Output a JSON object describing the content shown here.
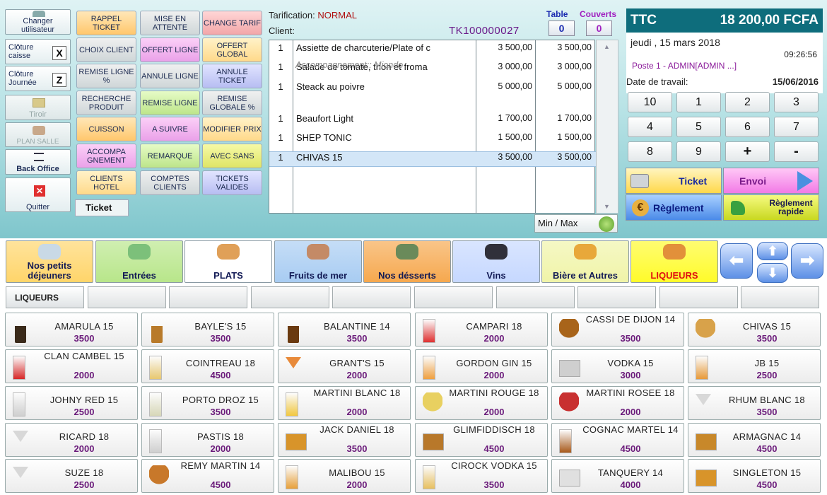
{
  "left": {
    "change_user": "Changer utilisateur",
    "cloture_caisse": "Clôture caisse",
    "cloture_caisse_key": "X",
    "cloture_journee": "Clôture Journée",
    "cloture_journee_key": "Z",
    "tiroir": "Tiroir",
    "plan_salle": "PLAN SALLE",
    "back_office": "Back Office",
    "quitter": "Quitter"
  },
  "functions": [
    {
      "label": "RAPPEL TICKET",
      "color": "or"
    },
    {
      "label": "MISE EN ATTENTE",
      "color": "gr"
    },
    {
      "label": "CHANGE TARIF",
      "color": "rd"
    },
    {
      "label": "CHOIX CLIENT",
      "color": "gr"
    },
    {
      "label": "OFFERT LIGNE",
      "color": "pk"
    },
    {
      "label": "OFFERT GLOBAL",
      "color": "py"
    },
    {
      "label": "REMISE LIGNE %",
      "color": "gr"
    },
    {
      "label": "ANNULE LIGNE",
      "color": "gr"
    },
    {
      "label": "ANNULE TICKET",
      "color": "bl"
    },
    {
      "label": "RECHERCHE PRODUIT",
      "color": "gr"
    },
    {
      "label": "REMISE LIGNE",
      "color": "lg"
    },
    {
      "label": "REMISE GLOBALE %",
      "color": "gr"
    },
    {
      "label": "CUISSON",
      "color": "or"
    },
    {
      "label": "A SUIVRE",
      "color": "pk"
    },
    {
      "label": "MODIFIER PRIX",
      "color": "py"
    },
    {
      "label": "ACCOMPA GNEMENT",
      "color": "pk"
    },
    {
      "label": "REMARQUE",
      "color": "lg"
    },
    {
      "label": "AVEC SANS",
      "color": "yl"
    },
    {
      "label": "CLIENTS HOTEL",
      "color": "py"
    },
    {
      "label": "COMPTES CLIENTS",
      "color": "gr"
    },
    {
      "label": "TICKETS VALIDES",
      "color": "bl"
    }
  ],
  "ticket_tab": "Ticket",
  "order": {
    "tarification_label": "Tarification:",
    "tarification_value": "NORMAL",
    "client_label": "Client:",
    "ticket_no": "TK100000027",
    "table_label": "Table",
    "couverts_label": "Couverts",
    "table_value": "0",
    "couverts_value": "0",
    "accompagnement": "Accompagnement:: Miondo",
    "lines": [
      {
        "qty": "1",
        "name": "Assiette de charcuterie/Plate of c",
        "price": "3 500,00",
        "total": "3 500,00"
      },
      {
        "qty": "1",
        "name": "Salade de tomate, thon et froma",
        "price": "3 000,00",
        "total": "3 000,00"
      },
      {
        "qty": "1",
        "name": "Steack au poivre",
        "price": "5 000,00",
        "total": "5 000,00"
      },
      {
        "qty": "1",
        "name": "Beaufort Light",
        "price": "1 700,00",
        "total": "1 700,00"
      },
      {
        "qty": "1",
        "name": "SHEP TONIC",
        "price": "1 500,00",
        "total": "1 500,00"
      },
      {
        "qty": "1",
        "name": "CHIVAS 15",
        "price": "3 500,00",
        "total": "3 500,00"
      }
    ],
    "minmax": "Min / Max"
  },
  "right": {
    "ttc_label": "TTC",
    "ttc_value": "18 200,00 FCFA",
    "date": "jeudi , 15 mars 2018",
    "time": "09:26:56",
    "poste": "Poste 1 - ADMIN[ADMIN ...]",
    "work_date_label": "Date de travail:",
    "work_date": "15/06/2016",
    "keys": [
      "10",
      "1",
      "2",
      "3",
      "4",
      "5",
      "6",
      "7",
      "8",
      "9",
      "+",
      "-"
    ],
    "ticket_btn": "Ticket",
    "envoi_btn": "Envoi",
    "reglement_btn": "Règlement",
    "reglement_rapide_btn": "Règlement rapide"
  },
  "categories": [
    {
      "label": "Nos petits déjeuners",
      "color": "#ffd56a",
      "accent": "#c9d9e6"
    },
    {
      "label": "Entrées",
      "color": "#b8e68a",
      "accent": "#7cc07a"
    },
    {
      "label": "PLATS",
      "color": "#ffffff",
      "accent": "#e0a058"
    },
    {
      "label": "Fruits de mer",
      "color": "#a8ccf2",
      "accent": "#c48a66"
    },
    {
      "label": "Nos désserts",
      "color": "#f6a84e",
      "accent": "#6a8a5a"
    },
    {
      "label": "Vins",
      "color": "#c6d8ff",
      "accent": "#30303a"
    },
    {
      "label": "Bière et Autres",
      "color": "#f0f4a8",
      "accent": "#e8a83a"
    },
    {
      "label": "LIQUEURS",
      "color": "#fffb2a",
      "accent": "#e2903a",
      "text_color": "#e01010"
    }
  ],
  "subcategory": "LIQUEURS",
  "products": [
    {
      "name": "AMARULA 15",
      "price": "3500",
      "icon": "bottle-icon",
      "c": "#3a2a1a"
    },
    {
      "name": "BAYLE'S 15",
      "price": "3500",
      "icon": "bottle-icon",
      "c": "#b87a2a"
    },
    {
      "name": "BALANTINE 14",
      "price": "3500",
      "icon": "bottle-icon",
      "c": "#6a3a10"
    },
    {
      "name": "CAMPARI 18",
      "price": "2000",
      "icon": "glass-icon",
      "c": "#e03030"
    },
    {
      "name": "CASSI DE DIJON 14",
      "price": "3500",
      "icon": "snifter-icon",
      "c": "#a8641a"
    },
    {
      "name": "CHIVAS 15",
      "price": "3500",
      "icon": "snifter-icon",
      "c": "#d8a24a"
    },
    {
      "name": "CLAN CAMBEL 15",
      "price": "2000",
      "icon": "glass-icon",
      "c": "#d82828"
    },
    {
      "name": "COINTREAU 18",
      "price": "4500",
      "icon": "glass-icon",
      "c": "#e8c870"
    },
    {
      "name": "GRANT'S 15",
      "price": "2000",
      "icon": "cocktail-icon",
      "c": "#e88a3a"
    },
    {
      "name": "GORDON GIN 15",
      "price": "2000",
      "icon": "glass-icon",
      "c": "#f0a040"
    },
    {
      "name": "VODKA 15",
      "price": "3000",
      "icon": "rocks-glass-icon",
      "c": "#cfcfcf"
    },
    {
      "name": "JB 15",
      "price": "2500",
      "icon": "glass-icon",
      "c": "#e89a3a"
    },
    {
      "name": "JOHNY RED 15",
      "price": "2500",
      "icon": "glass-icon",
      "c": "#d0d0d0"
    },
    {
      "name": "PORTO DROZ 15",
      "price": "3500",
      "icon": "glass-icon",
      "c": "#d8d8b8"
    },
    {
      "name": "MARTINI BLANC 18",
      "price": "2000",
      "icon": "glass-icon",
      "c": "#f2c840"
    },
    {
      "name": "MARTINI ROUGE 18",
      "price": "2000",
      "icon": "goblet-icon",
      "c": "#e8d060"
    },
    {
      "name": "MARTINI ROSEE 18",
      "price": "2000",
      "icon": "wine-glass-icon",
      "c": "#c83030"
    },
    {
      "name": "RHUM BLANC 18",
      "price": "3500",
      "icon": "cocktail-icon",
      "c": "#d8d8d8"
    },
    {
      "name": "RICARD 18",
      "price": "2000",
      "icon": "cocktail-icon",
      "c": "#d8d8d8"
    },
    {
      "name": "PASTIS 18",
      "price": "2000",
      "icon": "glass-icon",
      "c": "#cfcfcf"
    },
    {
      "name": "JACK DANIEL 18",
      "price": "3500",
      "icon": "rocks-glass-icon",
      "c": "#d8942a"
    },
    {
      "name": "GLIMFIDDISCH 18",
      "price": "4500",
      "icon": "rocks-glass-icon",
      "c": "#b8782a"
    },
    {
      "name": "COGNAC MARTEL 14",
      "price": "4500",
      "icon": "glass-icon",
      "c": "#a85a1a"
    },
    {
      "name": "ARMAGNAC 14",
      "price": "4500",
      "icon": "rocks-glass-icon",
      "c": "#c8882a"
    },
    {
      "name": "SUZE 18",
      "price": "2500",
      "icon": "cocktail-icon",
      "c": "#d8d8d8"
    },
    {
      "name": "REMY MARTIN 14",
      "price": "4500",
      "icon": "snifter-icon",
      "c": "#c8782a"
    },
    {
      "name": "MALIBOU 15",
      "price": "2000",
      "icon": "glass-icon",
      "c": "#e8a03a"
    },
    {
      "name": "CIROCK VODKA 15",
      "price": "3500",
      "icon": "glass-icon",
      "c": "#e8c060"
    },
    {
      "name": "TANQUERY 14",
      "price": "4000",
      "icon": "rocks-glass-icon",
      "c": "#e0e0e0"
    },
    {
      "name": "SINGLETON 15",
      "price": "4500",
      "icon": "rocks-glass-icon",
      "c": "#d8942a"
    }
  ]
}
